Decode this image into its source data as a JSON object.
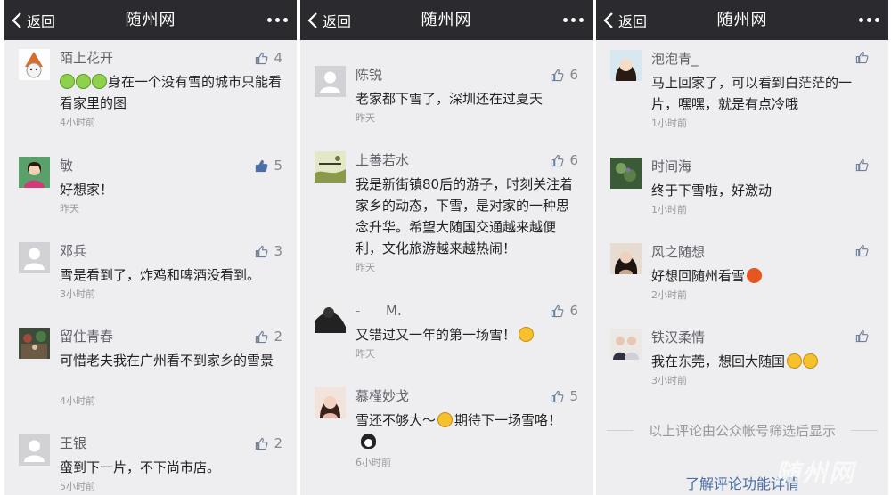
{
  "navbar": {
    "back_label": "返回",
    "title": "随州网"
  },
  "panels": [
    {
      "comments": [
        {
          "name": "陌上花开",
          "likes": "4",
          "liked": false,
          "pre_emojis": 3,
          "text": "身在一个没有雪的城市只能看看家里的图",
          "time": "4小时前"
        },
        {
          "name": "敏",
          "likes": "5",
          "liked": true,
          "text": "好想家！",
          "time": "昨天"
        },
        {
          "name": "邓兵",
          "likes": "3",
          "liked": false,
          "text": "雪是看到了，炸鸡和啤酒没看到。",
          "time": "3小时前"
        },
        {
          "name": "留住青春",
          "likes": "2",
          "liked": false,
          "text": "可惜老夫我在广州看不到家乡的雪景",
          "time": "4小时前"
        },
        {
          "name": "王银",
          "likes": "2",
          "liked": false,
          "text": "蛮到下一片，不下尚市店。",
          "time": "5小时前"
        }
      ]
    },
    {
      "comments": [
        {
          "name": "陈锐",
          "likes": "6",
          "liked": false,
          "text": "老家都下雪了，深圳还在过夏天",
          "time": "昨天"
        },
        {
          "name": "上善若水",
          "likes": "6",
          "liked": false,
          "text": "我是新街镇80后的游子，时刻关注着家乡的动态，下雪，是对家的一种思念升华。希望大随国交通越来越便利，文化旅游越来越热闹！",
          "time": "昨天"
        },
        {
          "name": "-      M.",
          "likes": "6",
          "liked": false,
          "text": "又错过又一年的第一场雪！",
          "time": "昨天"
        },
        {
          "name": "慕槿妙戈",
          "likes": "5",
          "liked": false,
          "text_a": "雪还不够大～",
          "text_b": "期待下一场雪咯！",
          "time": "6小时前"
        }
      ]
    },
    {
      "comments": [
        {
          "name": "泡泡青_",
          "likes": "",
          "liked": false,
          "text": "马上回家了，可以看到白茫茫的一片，嘿嘿，就是有点冷哦",
          "time": "1小时前"
        },
        {
          "name": "时间海",
          "likes": "",
          "liked": false,
          "text": "终于下雪啦，好激动",
          "time": "1小时前"
        },
        {
          "name": "风之随想",
          "likes": "",
          "liked": false,
          "text": "好想回随州看雪",
          "time": "2小时前"
        },
        {
          "name": "铁汉柔情",
          "likes": "",
          "liked": false,
          "text": "我在东莞，想回大随国",
          "time": "3小时前"
        }
      ],
      "footer_note": "以上评论由公众帐号筛选后显示",
      "learn_more": "了解评论功能详情"
    }
  ],
  "watermark": "随州网",
  "colors": {
    "navbar": "#2b2b2f",
    "panel_bg": "#eeeef0",
    "like_active": "#4a6fa5",
    "link": "#4a6fa5"
  },
  "icons": {
    "back": "chevron-left-icon",
    "more": "more-dots-icon",
    "like": "thumbs-up-icon",
    "avatar_default": "default-avatar-icon"
  }
}
